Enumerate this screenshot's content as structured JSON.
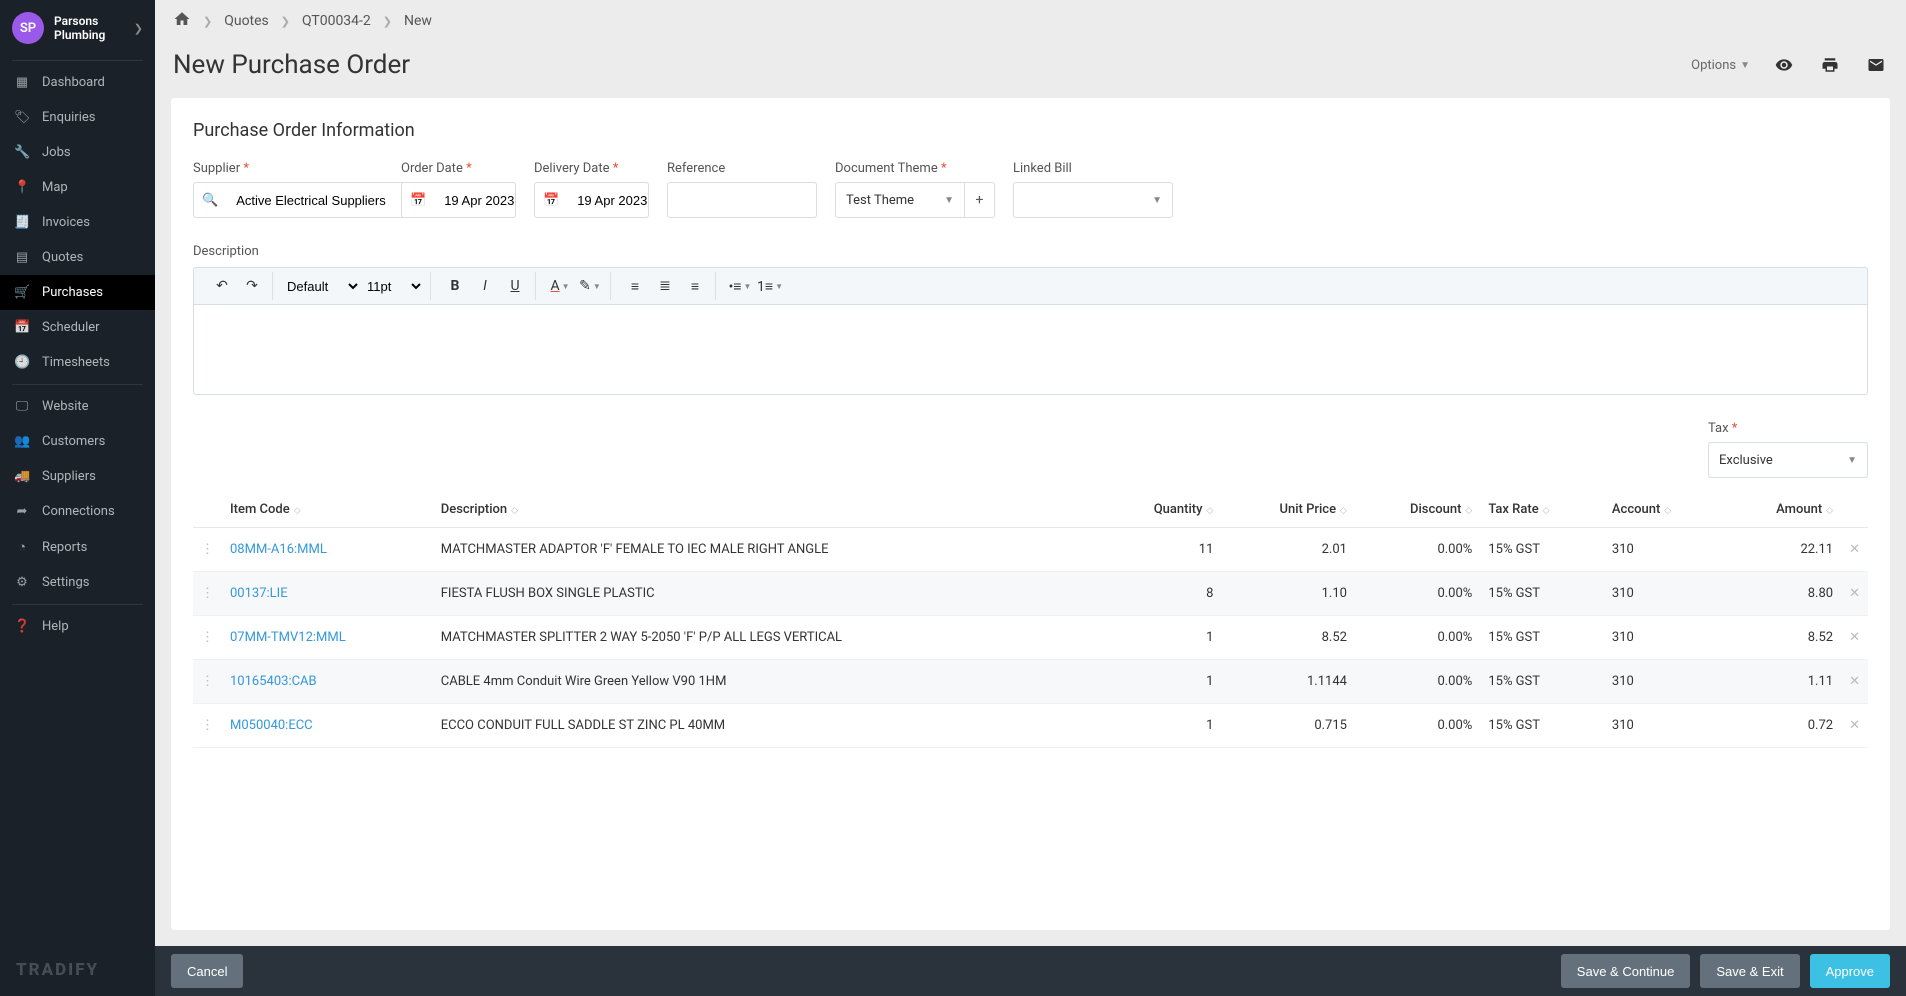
{
  "company": {
    "initials": "SP",
    "line1": "Parsons",
    "line2": "Plumbing"
  },
  "sidebar": {
    "items": [
      {
        "label": "Dashboard",
        "icon": "dashboard"
      },
      {
        "label": "Enquiries",
        "icon": "tag"
      },
      {
        "label": "Jobs",
        "icon": "wrench"
      },
      {
        "label": "Map",
        "icon": "pin"
      },
      {
        "label": "Invoices",
        "icon": "doc"
      },
      {
        "label": "Quotes",
        "icon": "grid"
      },
      {
        "label": "Purchases",
        "icon": "cart"
      },
      {
        "label": "Scheduler",
        "icon": "calendar"
      },
      {
        "label": "Timesheets",
        "icon": "clock"
      }
    ],
    "secondary": [
      {
        "label": "Website",
        "icon": "screen"
      },
      {
        "label": "Customers",
        "icon": "users"
      },
      {
        "label": "Suppliers",
        "icon": "truck"
      },
      {
        "label": "Connections",
        "icon": "share"
      },
      {
        "label": "Reports",
        "icon": "pie"
      },
      {
        "label": "Settings",
        "icon": "gear"
      }
    ],
    "help": {
      "label": "Help",
      "icon": "help"
    }
  },
  "breadcrumb": {
    "quotes": "Quotes",
    "qnum": "QT00034-2",
    "new": "New"
  },
  "title": "New Purchase Order",
  "options_label": "Options",
  "section_title": "Purchase Order Information",
  "fields": {
    "supplier_label": "Supplier",
    "supplier_value": "Active Electrical Suppliers",
    "order_date_label": "Order Date",
    "order_date_value": "19 Apr 2023",
    "delivery_date_label": "Delivery Date",
    "delivery_date_value": "19 Apr 2023",
    "reference_label": "Reference",
    "reference_value": "",
    "theme_label": "Document Theme",
    "theme_value": "Test Theme",
    "linked_bill_label": "Linked Bill",
    "linked_bill_value": "",
    "description_label": "Description",
    "tax_label": "Tax",
    "tax_value": "Exclusive"
  },
  "editor": {
    "font_family": "Default",
    "font_size": "11pt"
  },
  "tableHeaders": {
    "item_code": "Item Code",
    "description": "Description",
    "quantity": "Quantity",
    "unit_price": "Unit Price",
    "discount": "Discount",
    "tax_rate": "Tax Rate",
    "account": "Account",
    "amount": "Amount"
  },
  "rows": [
    {
      "code": "08MM-A16:MML",
      "desc": "MATCHMASTER ADAPTOR 'F' FEMALE TO IEC MALE RIGHT ANGLE",
      "qty": "11",
      "unit": "2.01",
      "disc": "0.00%",
      "tax": "15% GST",
      "acct": "310",
      "amount": "22.11"
    },
    {
      "code": "00137:LIE",
      "desc": "FIESTA FLUSH BOX SINGLE PLASTIC",
      "qty": "8",
      "unit": "1.10",
      "disc": "0.00%",
      "tax": "15% GST",
      "acct": "310",
      "amount": "8.80"
    },
    {
      "code": "07MM-TMV12:MML",
      "desc": "MATCHMASTER SPLITTER 2 WAY 5-2050 'F' P/P ALL LEGS VERTICAL",
      "qty": "1",
      "unit": "8.52",
      "disc": "0.00%",
      "tax": "15% GST",
      "acct": "310",
      "amount": "8.52"
    },
    {
      "code": "10165403:CAB",
      "desc": "CABLE 4mm Conduit Wire Green Yellow V90  1HM",
      "qty": "1",
      "unit": "1.1144",
      "disc": "0.00%",
      "tax": "15% GST",
      "acct": "310",
      "amount": "1.11"
    },
    {
      "code": "M050040:ECC",
      "desc": "ECCO CONDUIT FULL SADDLE ST ZINC PL 40MM",
      "qty": "1",
      "unit": "0.715",
      "disc": "0.00%",
      "tax": "15% GST",
      "acct": "310",
      "amount": "0.72"
    }
  ],
  "footer": {
    "cancel": "Cancel",
    "save_continue": "Save & Continue",
    "save_exit": "Save & Exit",
    "approve": "Approve"
  },
  "logo": "TRADIFY"
}
